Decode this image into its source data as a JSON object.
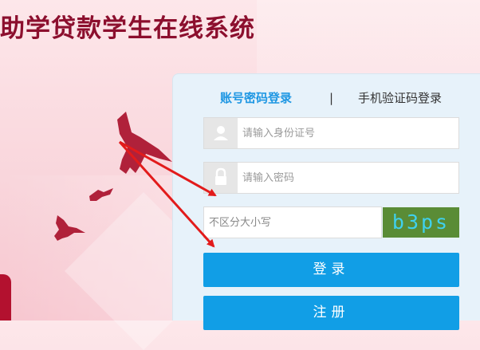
{
  "header": {
    "title": "助学贷款学生在线系统"
  },
  "login": {
    "tabs": {
      "account": "账号密码登录",
      "separator": "|",
      "phone": "手机验证码登录"
    },
    "id_field": {
      "placeholder": "请输入身份证号",
      "icon": "user-icon"
    },
    "password_field": {
      "placeholder": "请输入密码",
      "icon": "lock-icon"
    },
    "captcha": {
      "placeholder": "不区分大小写",
      "code": "b3ps"
    },
    "login_button": "登录",
    "register_button": "注册"
  },
  "colors": {
    "title": "#8c0f2e",
    "accent": "#1f97e3",
    "button": "#119ee6",
    "arrow": "#e21b1b"
  }
}
